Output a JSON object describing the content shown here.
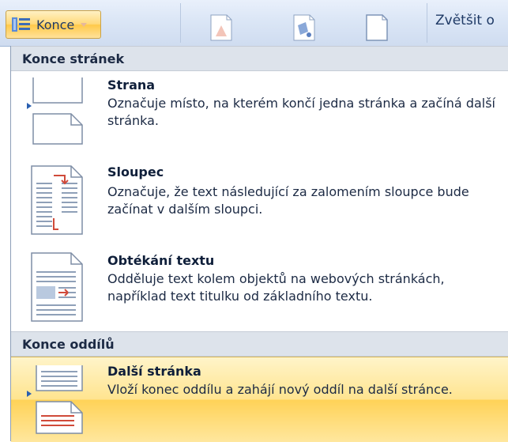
{
  "ribbon": {
    "konce_label": "Konce",
    "zoom_label": "Zvětšit o"
  },
  "menu": {
    "sections": [
      {
        "header": "Konce stránek",
        "items": [
          {
            "title": "Strana",
            "desc": "Označuje místo, na kterém končí jedna stránka a začíná další stránka."
          },
          {
            "title": "Sloupec",
            "desc": "Označuje, že text následující za zalomením sloupce bude začínat v dalším sloupci."
          },
          {
            "title": "Obtékání textu",
            "desc": "Odděluje text kolem objektů na webových stránkách, například text titulku od základního textu."
          }
        ]
      },
      {
        "header": "Konce oddílů",
        "items": [
          {
            "title": "Další stránka",
            "desc": "Vloží konec oddílu a zahájí nový oddíl na další stránce."
          }
        ]
      }
    ]
  },
  "colors": {
    "highlight": "#ffd257",
    "accent_red": "#d04a3a",
    "pointer_blue": "#2a5fb0"
  }
}
